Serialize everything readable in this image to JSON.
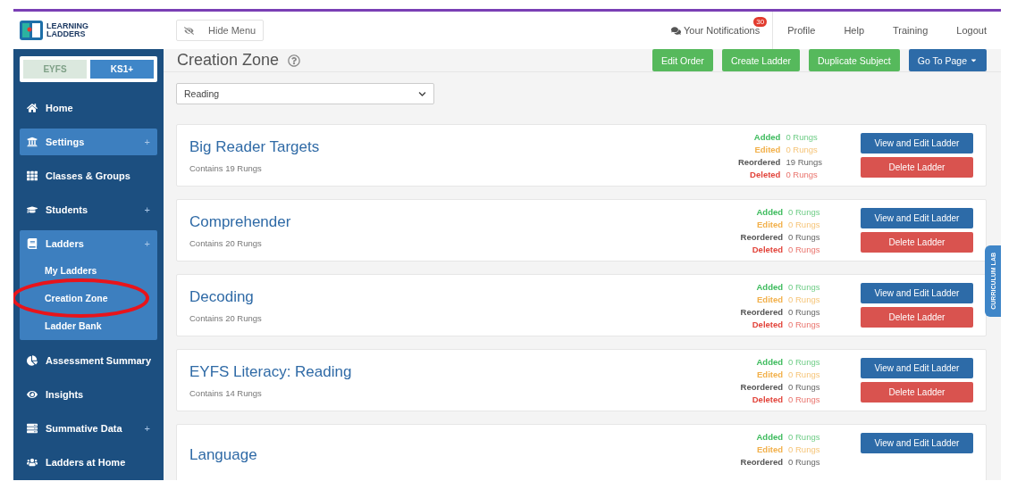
{
  "logo": {
    "line_1": "LEARNING",
    "line_2": "LADDERS"
  },
  "header": {
    "hide_menu": "Hide Menu",
    "notifications": {
      "label": "Your Notifications",
      "count": "30"
    },
    "links": [
      "Profile",
      "Help",
      "Training",
      "Logout"
    ]
  },
  "level_toggle": [
    {
      "label": "EYFS",
      "selected": false
    },
    {
      "label": "KS1+",
      "selected": true
    }
  ],
  "sidebar": {
    "items": [
      {
        "kind": "home",
        "label": "Home",
        "highlighted": false
      },
      {
        "kind": "bank",
        "label": "Settings",
        "expand_mark": "+",
        "highlighted": true
      },
      {
        "kind": "grid",
        "label": "Classes & Groups",
        "highlighted": false
      },
      {
        "kind": "cap",
        "label": "Students",
        "expand_mark": "+",
        "highlighted": false
      },
      {
        "kind": "book",
        "label": "Ladders",
        "expand_mark": "+",
        "highlighted": true,
        "children": [
          {
            "label": "My Ladders",
            "circled": false
          },
          {
            "label": "Creation Zone",
            "circled": true
          },
          {
            "label": "Ladder Bank",
            "circled": false
          }
        ]
      },
      {
        "kind": "pie",
        "label": "Assessment Summary",
        "highlighted": false
      },
      {
        "kind": "eye",
        "label": "Insights",
        "highlighted": false
      },
      {
        "kind": "stack",
        "label": "Summative Data",
        "expand_mark": "+",
        "highlighted": false
      },
      {
        "kind": "users",
        "label": "Ladders at Home",
        "highlighted": false
      }
    ]
  },
  "page": {
    "title": "Creation Zone",
    "actions": [
      {
        "label": "Edit Order",
        "kind": "success"
      },
      {
        "label": "Create Ladder",
        "kind": "success"
      },
      {
        "label": "Duplicate Subject",
        "kind": "success"
      },
      {
        "label": "Go To Page",
        "kind": "dropdown"
      }
    ]
  },
  "subject_select": {
    "value": "Reading"
  },
  "side_tab": "CURRICULUM LAB",
  "ladders": [
    {
      "title": "Big Reader Targets",
      "subtitle": "Contains 19 Rungs",
      "stats": [
        {
          "kind": "added",
          "label": "Added",
          "value": "0 Rungs"
        },
        {
          "kind": "edited",
          "label": "Edited",
          "value": "0 Rungs"
        },
        {
          "kind": "reordered",
          "label": "Reordered",
          "value": "19 Rungs"
        },
        {
          "kind": "deleted",
          "label": "Deleted",
          "value": "0 Rungs"
        }
      ],
      "buttons": [
        {
          "kind": "view",
          "label": "View and Edit Ladder"
        },
        {
          "kind": "delete",
          "label": "Delete Ladder"
        }
      ]
    },
    {
      "title": "Comprehender",
      "subtitle": "Contains 20 Rungs",
      "stats": [
        {
          "kind": "added",
          "label": "Added",
          "value": "0 Rungs"
        },
        {
          "kind": "edited",
          "label": "Edited",
          "value": "0 Rungs"
        },
        {
          "kind": "reordered",
          "label": "Reordered",
          "value": "0 Rungs"
        },
        {
          "kind": "deleted",
          "label": "Deleted",
          "value": "0 Rungs"
        }
      ],
      "buttons": [
        {
          "kind": "view",
          "label": "View and Edit Ladder"
        },
        {
          "kind": "delete",
          "label": "Delete Ladder"
        }
      ]
    },
    {
      "title": "Decoding",
      "subtitle": "Contains 20 Rungs",
      "stats": [
        {
          "kind": "added",
          "label": "Added",
          "value": "0 Rungs"
        },
        {
          "kind": "edited",
          "label": "Edited",
          "value": "0 Rungs"
        },
        {
          "kind": "reordered",
          "label": "Reordered",
          "value": "0 Rungs"
        },
        {
          "kind": "deleted",
          "label": "Deleted",
          "value": "0 Rungs"
        }
      ],
      "buttons": [
        {
          "kind": "view",
          "label": "View and Edit Ladder"
        },
        {
          "kind": "delete",
          "label": "Delete Ladder"
        }
      ]
    },
    {
      "title": "EYFS Literacy: Reading",
      "subtitle": "Contains 14 Rungs",
      "stats": [
        {
          "kind": "added",
          "label": "Added",
          "value": "0 Rungs"
        },
        {
          "kind": "edited",
          "label": "Edited",
          "value": "0 Rungs"
        },
        {
          "kind": "reordered",
          "label": "Reordered",
          "value": "0 Rungs"
        },
        {
          "kind": "deleted",
          "label": "Deleted",
          "value": "0 Rungs"
        }
      ],
      "buttons": [
        {
          "kind": "view",
          "label": "View and Edit Ladder"
        },
        {
          "kind": "delete",
          "label": "Delete Ladder"
        }
      ]
    },
    {
      "title": "Language",
      "stats": [
        {
          "kind": "added",
          "label": "Added",
          "value": "0 Rungs"
        },
        {
          "kind": "edited",
          "label": "Edited",
          "value": "0 Rungs"
        },
        {
          "kind": "reordered",
          "label": "Reordered",
          "value": "0 Rungs"
        }
      ],
      "buttons": [
        {
          "kind": "view",
          "label": "View and Edit Ladder"
        }
      ]
    }
  ]
}
